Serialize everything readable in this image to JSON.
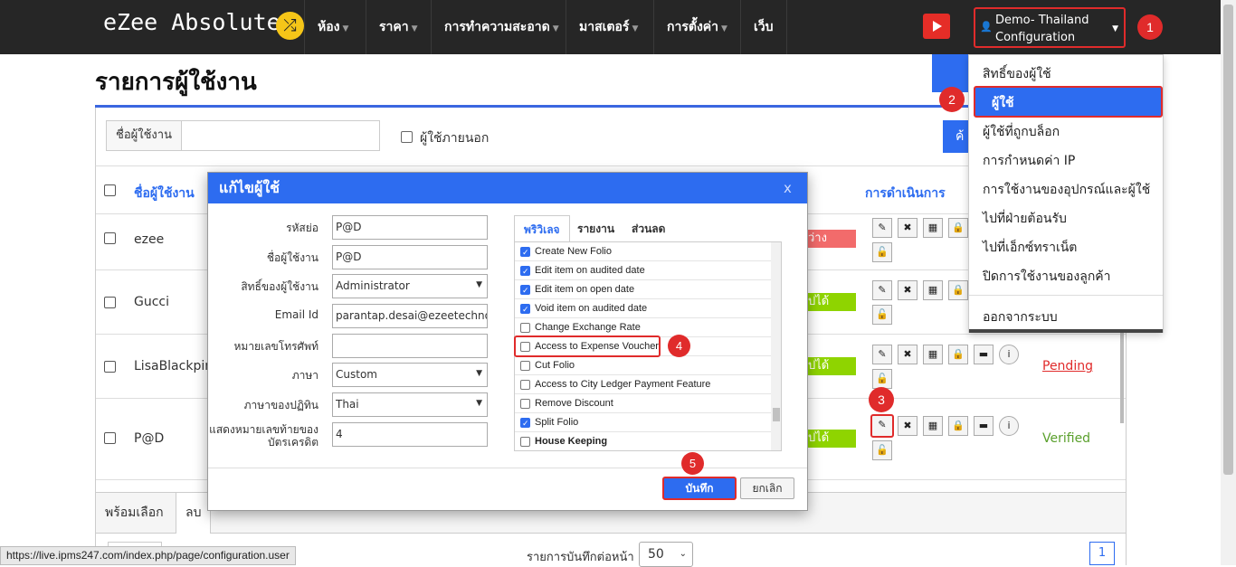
{
  "nav": {
    "brand": "eZee Absolute",
    "items": [
      {
        "label": "ห้อง",
        "dropdown": true
      },
      {
        "label": "ราคา",
        "dropdown": true
      },
      {
        "label": "การทำความสะอาด",
        "dropdown": true
      },
      {
        "label": "มาสเตอร์",
        "dropdown": true
      },
      {
        "label": "การตั้งค่า",
        "dropdown": true
      },
      {
        "label": "เว็บ",
        "dropdown": false
      }
    ],
    "user_line1": "Demo- Thailand",
    "user_line2": "Configuration"
  },
  "dropdown_menu": {
    "items": [
      "สิทธิ์ของผู้ใช้",
      "ผู้ใช้",
      "ผู้ใช้ที่ถูกบล็อก",
      "การกำหนดค่า IP",
      "การใช้งานของอุปกรณ์และผู้ใช้",
      "ไปที่ฝ่ายต้อนรับ",
      "ไปที่เอ็กซ์ทราเน็ต",
      "ปิดการใช้งานของลูกค้า"
    ],
    "logout": "ออกจากระบบ"
  },
  "page": {
    "title": "รายการผู้ใช้งาน",
    "filter_label": "ชื่อผู้ใช้งาน",
    "external_user_label": "ผู้ใช้ภายนอก",
    "search_button": "ค้"
  },
  "table": {
    "col_user": "ชื่อผู้ใช้งาน",
    "col_actions": "การดำเนินการ",
    "rows": [
      {
        "name": "ezee",
        "status_fragment": "ว่าง",
        "status_link": ""
      },
      {
        "name": "Gucci",
        "status_fragment": "ปได้",
        "status_link": ""
      },
      {
        "name": "LisaBlackpin",
        "status_fragment": "ปได้",
        "status_link": "Pending"
      },
      {
        "name": "P@D",
        "status_fragment": "ปได้",
        "status_link": "Verified"
      }
    ]
  },
  "bottom": {
    "select_all": "พร้อมเลือก",
    "delete": "ลบ",
    "per_page_label": "รายการบันทึกต่อหน้า",
    "per_page_value": "50",
    "page_number": "1"
  },
  "statusbar_url": "https://live.ipms247.com/index.php/page/configuration.user",
  "modal": {
    "title": "แก้ไขผู้ใช้",
    "close": "x",
    "fields": [
      {
        "label": "รหัสย่อ",
        "value": "P@D"
      },
      {
        "label": "ชื่อผู้ใช้งาน",
        "value": "P@D"
      },
      {
        "label": "สิทธิ์ของผู้ใช้งาน",
        "value": "Administrator"
      },
      {
        "label": "Email Id",
        "value": "parantap.desai@ezeetechnosys.c"
      },
      {
        "label": "หมายเลขโทรศัพท์",
        "value": ""
      },
      {
        "label": "ภาษา",
        "value": "Custom"
      },
      {
        "label": "ภาษาของปฏิทิน",
        "value": "Thai"
      },
      {
        "label": "แสดงหมายเลขท้ายของ บัตรเครดิต",
        "value": "4"
      }
    ],
    "tabs": [
      "พริวิเลจ",
      "รายงาน",
      "ส่วนลด"
    ],
    "permissions": [
      {
        "label": "Create New Folio",
        "checked": true
      },
      {
        "label": "Edit item on audited date",
        "checked": true
      },
      {
        "label": "Edit item on open date",
        "checked": true
      },
      {
        "label": "Void item on audited date",
        "checked": true
      },
      {
        "label": "Change Exchange Rate",
        "checked": false
      },
      {
        "label": "Access to Expense Voucher",
        "checked": false
      },
      {
        "label": "Cut Folio",
        "checked": false
      },
      {
        "label": "Access to City Ledger Payment Feature",
        "checked": false
      },
      {
        "label": "Remove Discount",
        "checked": false
      },
      {
        "label": "Split Folio",
        "checked": true
      },
      {
        "label": "House Keeping",
        "checked": false
      }
    ],
    "save": "บันทึก",
    "cancel": "ยกเลิก"
  },
  "step_badges": [
    "1",
    "2",
    "3",
    "4",
    "5"
  ],
  "colors": {
    "accent": "#2d6cf0",
    "highlight": "#e02b2b",
    "topbar": "#262626",
    "verified": "#5aa02c",
    "pending": "#e02b2b",
    "status_green": "#8fd400"
  }
}
